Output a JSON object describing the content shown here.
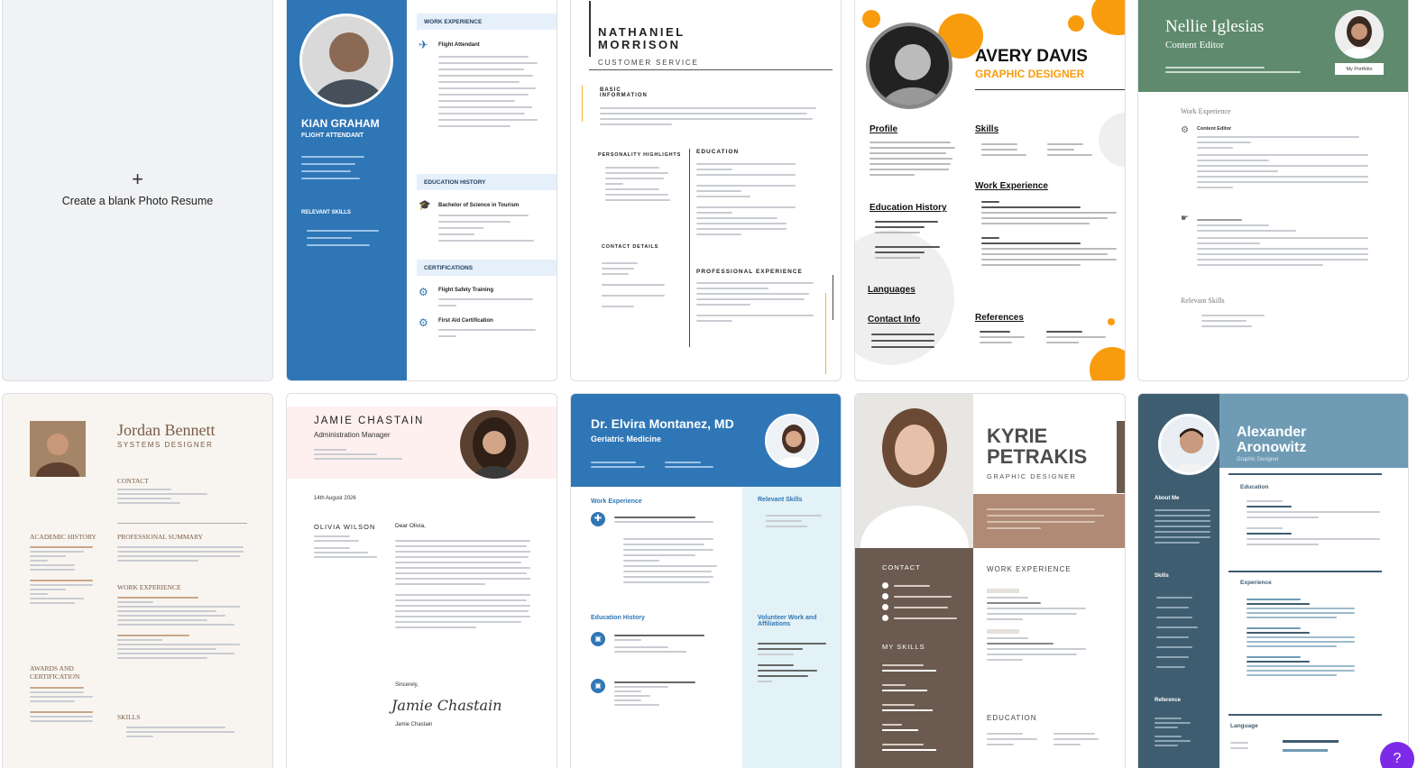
{
  "blank": {
    "label": "Create a blank Photo Resume",
    "plus": "+"
  },
  "kian": {
    "name": "KIAN GRAHAM",
    "role": "FLIGHT ATTENDANT",
    "sec1": "WORK EXPERIENCE",
    "job": "Flight Attendant",
    "sec2": "EDUCATION HISTORY",
    "degree": "Bachelor of Science in Tourism",
    "sec3": "CERTIFICATIONS",
    "cert1": "Flight Safety Training",
    "cert2": "First Aid Certification",
    "skills_h": "RELEVANT SKILLS"
  },
  "nathaniel": {
    "name1": "NATHANIEL",
    "name2": "MORRISON",
    "role": "CUSTOMER SERVICE",
    "s1": "BASIC INFORMATION",
    "s2": "PERSONALITY HIGHLIGHTS",
    "s3": "EDUCATION",
    "s4": "CONTACT DETAILS",
    "s5": "PROFESSIONAL EXPERIENCE"
  },
  "avery": {
    "name": "AVERY DAVIS",
    "role": "GRAPHIC DESIGNER",
    "s1": "Profile",
    "s2": "Skills",
    "s3": "Education History",
    "s4": "Work Experience",
    "s5": "Languages",
    "s6": "Contact Info",
    "s7": "References"
  },
  "nellie": {
    "name": "Nellie Iglesias",
    "role": "Content Editor",
    "portfolio": "My Portfolio",
    "s1": "Work Experience",
    "s2": "Relevant Skills",
    "job": "Content Editor"
  },
  "jordan": {
    "name": "Jordan Bennett",
    "role": "SYSTEMS DESIGNER",
    "s1": "CONTACT",
    "s2": "ACADEMIC HISTORY",
    "s3": "PROFESSIONAL SUMMARY",
    "s4": "WORK EXPERIENCE",
    "s5": "AWARDS AND CERTIFICATION",
    "s6": "SKILLS"
  },
  "jamie": {
    "name": "JAMIE CHASTAIN",
    "role": "Administration Manager",
    "date": "14th August 2026",
    "to": "OLIVIA WILSON",
    "greet": "Dear Olivia,",
    "sign": "Sincerely,",
    "signature": "Jamie Chastain",
    "signname": "Jamie Chastain"
  },
  "elvira": {
    "name": "Dr. Elvira Montanez, MD",
    "role": "Geriatric Medicine",
    "s1": "Work Experience",
    "s2": "Relevant Skills",
    "s3": "Education History",
    "s4": "Volunteer Work and Affiliations"
  },
  "kyrie": {
    "name1": "KYRIE",
    "name2": "PETRAKIS",
    "role": "GRAPHIC DESIGNER",
    "s1": "CONTACT",
    "s2": "WORK EXPERIENCE",
    "s3": "MY SKILLS",
    "s4": "EDUCATION"
  },
  "alexander": {
    "name1": "Alexander",
    "name2": "Aronowitz",
    "role": "Graphic Designer",
    "s1": "About Me",
    "s2": "Education",
    "s3": "Skills",
    "s4": "Experience",
    "s5": "Reference",
    "s6": "Language"
  },
  "help": {
    "label": "?"
  },
  "colors": {
    "blue": "#2f76b6",
    "orange": "#f89c0e",
    "green": "#5f8a6e",
    "brown": "#6a5a4f",
    "tan": "#b08a75",
    "slate": "#3f5d70",
    "purple": "#7d2ae8"
  }
}
